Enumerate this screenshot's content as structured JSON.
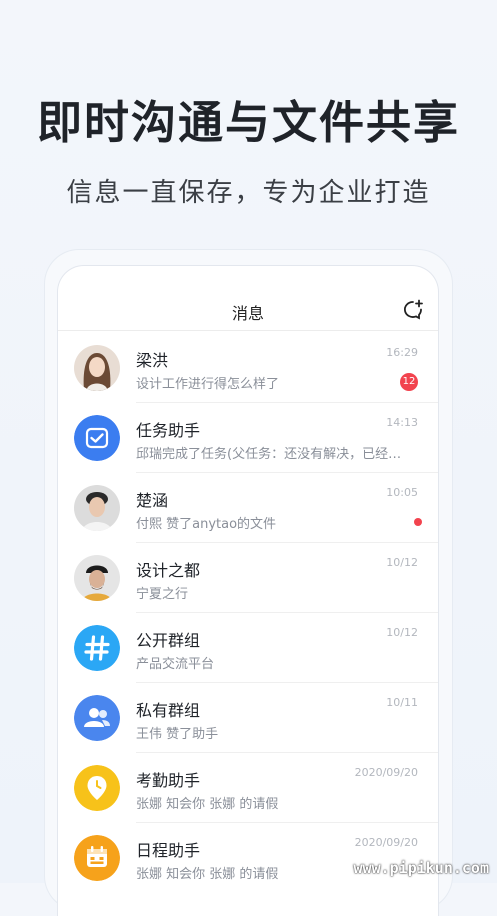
{
  "headline": "即时沟通与文件共享",
  "subline": "信息一直保存，专为企业打造",
  "app": {
    "title": "消息",
    "new_chat_icon": "new-chat-icon"
  },
  "conversations": [
    {
      "name": "梁洪",
      "preview": "设计工作进行得怎么样了",
      "time": "16:29",
      "badge": "12",
      "avatar": "photo-woman"
    },
    {
      "name": "任务助手",
      "preview": "邱瑞完成了任务(父任务：还没有解决，已经…",
      "time": "14:13",
      "avatar": "task-check-icon"
    },
    {
      "name": "楚涵",
      "preview": "付熙 赞了anytao的文件",
      "time": "10:05",
      "unread_dot": true,
      "avatar": "photo-man"
    },
    {
      "name": "设计之都",
      "preview": "宁夏之行",
      "time": "10/12",
      "avatar": "photo-man-beanie"
    },
    {
      "name": "公开群组",
      "preview": "产品交流平台",
      "time": "10/12",
      "avatar": "hashtag-icon"
    },
    {
      "name": "私有群组",
      "preview": "王伟 赞了助手",
      "time": "10/11",
      "avatar": "group-icon"
    },
    {
      "name": "考勤助手",
      "preview": "张娜 知会你 张娜 的请假",
      "time": "2020/09/20",
      "avatar": "location-clock-icon"
    },
    {
      "name": "日程助手",
      "preview": "张娜 知会你 张娜 的请假",
      "time": "2020/09/20",
      "avatar": "calendar-icon"
    }
  ],
  "colors": {
    "task": "#3b7df0",
    "hashtag": "#2ba7f5",
    "group": "#4a86ee",
    "attendance": "#f7c21a",
    "calendar": "#f6a21b",
    "badge": "#f2434e"
  },
  "watermark": "www.pipikun.com"
}
